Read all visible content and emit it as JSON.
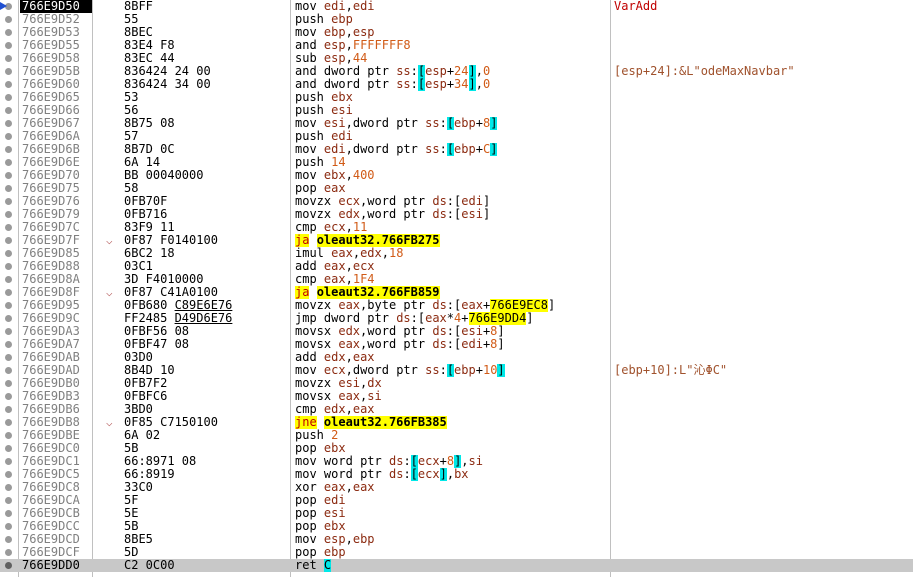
{
  "disassembly": {
    "rows": [
      {
        "addr": "766E9D50",
        "bytes": "8BFF",
        "instr": "mov edi,edi",
        "comment": "VarAdd",
        "eip": true
      },
      {
        "addr": "766E9D52",
        "bytes": "55",
        "instr": "push ebp"
      },
      {
        "addr": "766E9D53",
        "bytes": "8BEC",
        "instr": "mov ebp,esp"
      },
      {
        "addr": "766E9D55",
        "bytes": "83E4 F8",
        "instr": "and esp,FFFFFFF8"
      },
      {
        "addr": "766E9D58",
        "bytes": "83EC 44",
        "instr": "sub esp,44"
      },
      {
        "addr": "766E9D5B",
        "bytes": "836424 24 00",
        "instr": "and dword ptr ss:[esp+24],0",
        "comment": "[esp+24]:&L\"odeMaxNavbar\""
      },
      {
        "addr": "766E9D60",
        "bytes": "836424 34 00",
        "instr": "and dword ptr ss:[esp+34],0"
      },
      {
        "addr": "766E9D65",
        "bytes": "53",
        "instr": "push ebx"
      },
      {
        "addr": "766E9D66",
        "bytes": "56",
        "instr": "push esi"
      },
      {
        "addr": "766E9D67",
        "bytes": "8B75 08",
        "instr": "mov esi,dword ptr ss:[ebp+8]"
      },
      {
        "addr": "766E9D6A",
        "bytes": "57",
        "instr": "push edi"
      },
      {
        "addr": "766E9D6B",
        "bytes": "8B7D 0C",
        "instr": "mov edi,dword ptr ss:[ebp+C]"
      },
      {
        "addr": "766E9D6E",
        "bytes": "6A 14",
        "instr": "push 14"
      },
      {
        "addr": "766E9D70",
        "bytes": "BB 00040000",
        "instr": "mov ebx,400"
      },
      {
        "addr": "766E9D75",
        "bytes": "58",
        "instr": "pop eax"
      },
      {
        "addr": "766E9D76",
        "bytes": "0FB70F",
        "instr": "movzx ecx,word ptr ds:[edi]"
      },
      {
        "addr": "766E9D79",
        "bytes": "0FB716",
        "instr": "movzx edx,word ptr ds:[esi]"
      },
      {
        "addr": "766E9D7C",
        "bytes": "83F9 11",
        "instr": "cmp ecx,11"
      },
      {
        "addr": "766E9D7F",
        "bytes": "0F87 F0140100",
        "instr": "ja oleaut32.766FB275",
        "jump": true
      },
      {
        "addr": "766E9D85",
        "bytes": "6BC2 18",
        "instr": "imul eax,edx,18"
      },
      {
        "addr": "766E9D88",
        "bytes": "03C1",
        "instr": "add eax,ecx"
      },
      {
        "addr": "766E9D8A",
        "bytes": "3D F4010000",
        "instr": "cmp eax,1F4"
      },
      {
        "addr": "766E9D8F",
        "bytes": "0F87 C41A0100",
        "instr": "ja oleaut32.766FB859",
        "jump": true
      },
      {
        "addr": "766E9D95",
        "bytes": "0FB680 C89E6E76",
        "instr": "movzx eax,byte ptr ds:[eax+766E9EC8]",
        "bytes_ul": "C89E6E76"
      },
      {
        "addr": "766E9D9C",
        "bytes": "FF2485 D49D6E76",
        "instr": "jmp dword ptr ds:[eax*4+766E9DD4]",
        "bytes_ul": "D49D6E76"
      },
      {
        "addr": "766E9DA3",
        "bytes": "0FBF56 08",
        "instr": "movsx edx,word ptr ds:[esi+8]"
      },
      {
        "addr": "766E9DA7",
        "bytes": "0FBF47 08",
        "instr": "movsx eax,word ptr ds:[edi+8]"
      },
      {
        "addr": "766E9DAB",
        "bytes": "03D0",
        "instr": "add edx,eax"
      },
      {
        "addr": "766E9DAD",
        "bytes": "8B4D 10",
        "instr": "mov ecx,dword ptr ss:[ebp+10]",
        "comment": "[ebp+10]:L\"沁ΦC\""
      },
      {
        "addr": "766E9DB0",
        "bytes": "0FB7F2",
        "instr": "movzx esi,dx"
      },
      {
        "addr": "766E9DB3",
        "bytes": "0FBFC6",
        "instr": "movsx eax,si"
      },
      {
        "addr": "766E9DB6",
        "bytes": "3BD0",
        "instr": "cmp edx,eax"
      },
      {
        "addr": "766E9DB8",
        "bytes": "0F85 C7150100",
        "instr": "jne oleaut32.766FB385",
        "jump": true
      },
      {
        "addr": "766E9DBE",
        "bytes": "6A 02",
        "instr": "push 2"
      },
      {
        "addr": "766E9DC0",
        "bytes": "5B",
        "instr": "pop ebx"
      },
      {
        "addr": "766E9DC1",
        "bytes": "66:8971 08",
        "instr": "mov word ptr ds:[ecx+8],si"
      },
      {
        "addr": "766E9DC5",
        "bytes": "66:8919",
        "instr": "mov word ptr ds:[ecx],bx"
      },
      {
        "addr": "766E9DC8",
        "bytes": "33C0",
        "instr": "xor eax,eax"
      },
      {
        "addr": "766E9DCA",
        "bytes": "5F",
        "instr": "pop edi"
      },
      {
        "addr": "766E9DCB",
        "bytes": "5E",
        "instr": "pop esi"
      },
      {
        "addr": "766E9DCC",
        "bytes": "5B",
        "instr": "pop ebx"
      },
      {
        "addr": "766E9DCD",
        "bytes": "8BE5",
        "instr": "mov esp,ebp"
      },
      {
        "addr": "766E9DCF",
        "bytes": "5D",
        "instr": "pop ebp"
      },
      {
        "addr": "766E9DD0",
        "bytes": "C2 0C00",
        "instr": "ret C",
        "current": true
      }
    ]
  },
  "colors": {
    "address_gray": "#808080",
    "comment_brown": "#a0522d",
    "label_red": "#c00000",
    "jump_highlight": "#ffff00",
    "bracket_highlight": "#00e8e8",
    "current_line": "#c8c8c8",
    "eip_arrow": "#1f4fd1"
  },
  "icons": {
    "gutter": "breakpoint-dot-icon",
    "eip": "eip-arrow-icon",
    "jump": "jump-marker-icon"
  }
}
